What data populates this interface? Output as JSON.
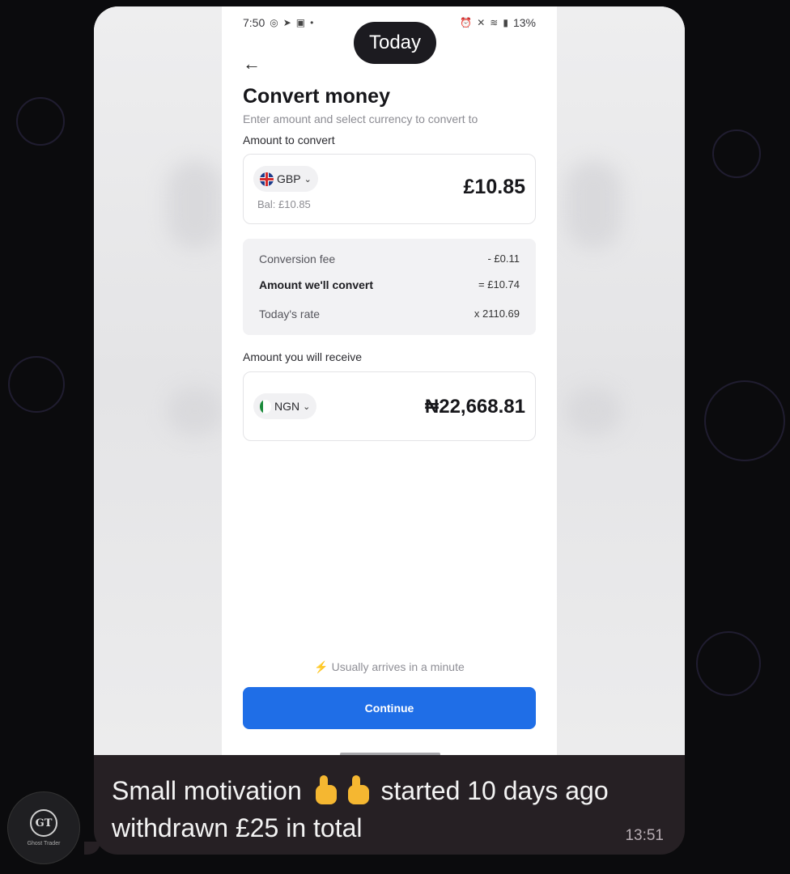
{
  "status_bar": {
    "time": "7:50",
    "battery": "13%"
  },
  "date_pill": "Today",
  "screen": {
    "title": "Convert money",
    "subtitle": "Enter amount and select currency to convert to",
    "amount_label": "Amount to convert",
    "from": {
      "currency": "GBP",
      "amount": "£10.85",
      "balance": "Bal: £10.85"
    },
    "summary": [
      {
        "label": "Conversion fee",
        "value": "- £0.11"
      },
      {
        "label": "Amount we'll convert",
        "value": "= £10.74"
      },
      {
        "label": "Today's rate",
        "value": "x 2110.69"
      }
    ],
    "receive_label": "Amount you will receive",
    "to": {
      "currency": "NGN",
      "amount": "₦22,668.81"
    },
    "arrival_note": "Usually arrives in a minute",
    "continue_label": "Continue"
  },
  "message": {
    "line1_pre": "Small motivation",
    "line1_post": "started 10 days ago",
    "line2": "withdrawn £25 in total",
    "time": "13:51"
  },
  "avatar": {
    "initials": "GT",
    "name": "Ghost Trader"
  },
  "colors": {
    "primary_button": "#1f6ee7",
    "bubble": "#262024",
    "wallpaper": "#0b0b0d"
  }
}
